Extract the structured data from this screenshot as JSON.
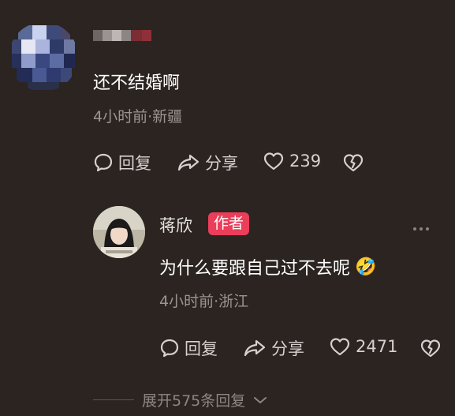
{
  "comment": {
    "text": "还不结婚啊",
    "meta": "4小时前·新疆",
    "actions": {
      "reply_label": "回复",
      "share_label": "分享",
      "like_count": "239"
    }
  },
  "reply": {
    "author": "蒋欣",
    "author_badge": "作者",
    "text": "为什么要跟自己过不去呢",
    "emoji": "🤣",
    "meta": "4小时前·浙江",
    "actions": {
      "reply_label": "回复",
      "share_label": "分享",
      "like_count": "2471"
    }
  },
  "expand_label": "展开575条回复",
  "colors": {
    "background": "#2b2421",
    "badge": "#ea3e5a",
    "secondary_text": "#9b9591"
  }
}
